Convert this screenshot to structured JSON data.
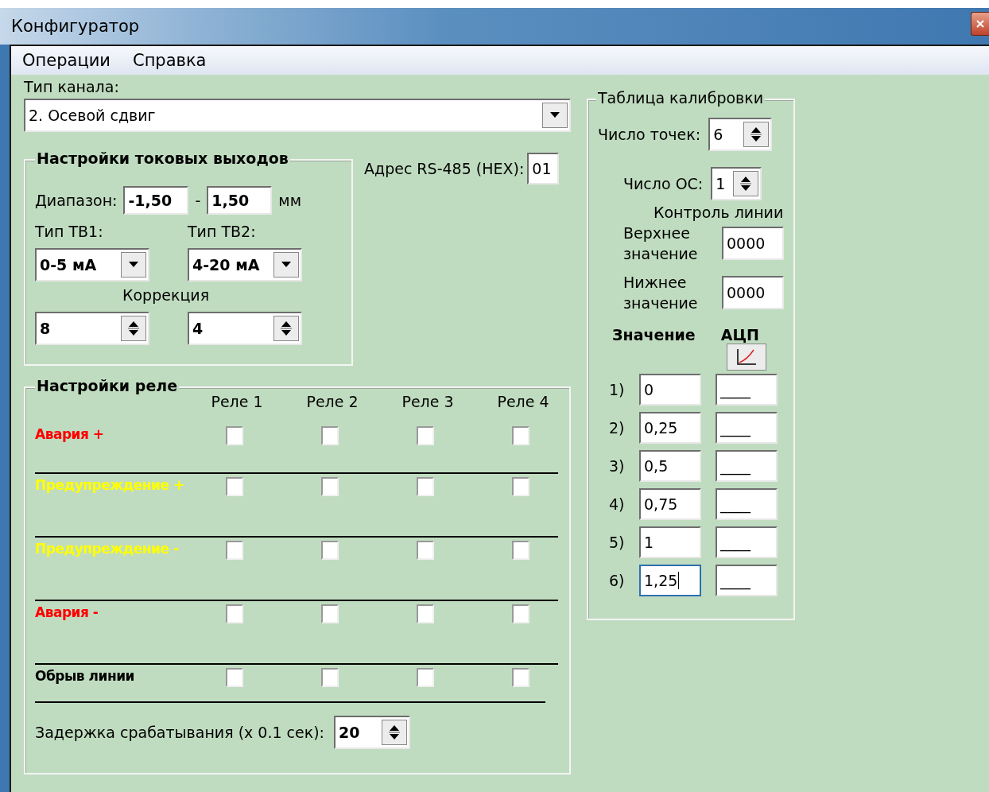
{
  "window": {
    "title": "Конфигуратор"
  },
  "menu": [
    {
      "label": "Операции"
    },
    {
      "label": "Справка"
    }
  ],
  "channel_type": {
    "label": "Тип канала:",
    "value": "2. Осевой сдвиг"
  },
  "current_outputs": {
    "title": "Настройки токовых выходов",
    "range_label": "Диапазон:",
    "range_from": "-1,50",
    "dash": "-",
    "range_to": "1,50",
    "unit": "мм",
    "tv1_label": "Тип ТВ1:",
    "tv1_value": "0-5 мА",
    "tv2_label": "Тип ТВ2:",
    "tv2_value": "4-20 мА",
    "correction_label": "Коррекция",
    "correction_1": "8",
    "correction_2": "4"
  },
  "address": {
    "label": "Адрес RS-485 (HEX):",
    "value": "01"
  },
  "relay": {
    "title": "Настройки реле",
    "columns": [
      "Реле 1",
      "Реле 2",
      "Реле 3",
      "Реле 4"
    ],
    "rows": [
      {
        "label": "Авария +",
        "color": "#ff0000",
        "checks": [
          {
            "checked": false
          },
          {
            "checked": false
          },
          {
            "checked": false
          },
          {
            "checked": false
          }
        ]
      },
      {
        "label": "Предупреждение +",
        "color": "#ffff00",
        "checks": [
          {
            "checked": false
          },
          {
            "checked": false
          },
          {
            "checked": false
          },
          {
            "checked": false
          }
        ]
      },
      {
        "label": "Предупреждение -",
        "color": "#ffff00",
        "checks": [
          {
            "checked": false
          },
          {
            "checked": false
          },
          {
            "checked": false
          },
          {
            "checked": false
          }
        ]
      },
      {
        "label": "Авария -",
        "color": "#ff0000",
        "checks": [
          {
            "checked": false
          },
          {
            "checked": false
          },
          {
            "checked": false
          },
          {
            "checked": false
          }
        ]
      },
      {
        "label": "Обрыв линии",
        "color": "#000000",
        "checks": [
          {
            "checked": false
          },
          {
            "checked": false
          },
          {
            "checked": false
          },
          {
            "checked": false
          }
        ]
      }
    ],
    "delay_label": "Задержка срабатывания (x 0.1 сек):",
    "delay_value": "20"
  },
  "calibration": {
    "title": "Таблица калибровки",
    "points_label": "Число точек:",
    "points_value": "6",
    "os_label": "Число ОС:",
    "os_value": "1",
    "line_control_label": "Контроль линии",
    "upper_label": "Верхнее значение",
    "upper_value": "0000",
    "lower_label": "Нижнее значение",
    "lower_value": "0000",
    "value_header": "Значение",
    "adc_header": "АЦП",
    "rows": [
      {
        "index": "1)",
        "value": "0",
        "adc": "____",
        "focused": false
      },
      {
        "index": "2)",
        "value": "0,25",
        "adc": "____",
        "focused": false
      },
      {
        "index": "3)",
        "value": "0,5",
        "adc": "____",
        "focused": false
      },
      {
        "index": "4)",
        "value": "0,75",
        "adc": "____",
        "focused": false
      },
      {
        "index": "5)",
        "value": "1",
        "adc": "____",
        "focused": false
      },
      {
        "index": "6)",
        "value": "1,25",
        "adc": "____",
        "focused": true
      }
    ]
  }
}
